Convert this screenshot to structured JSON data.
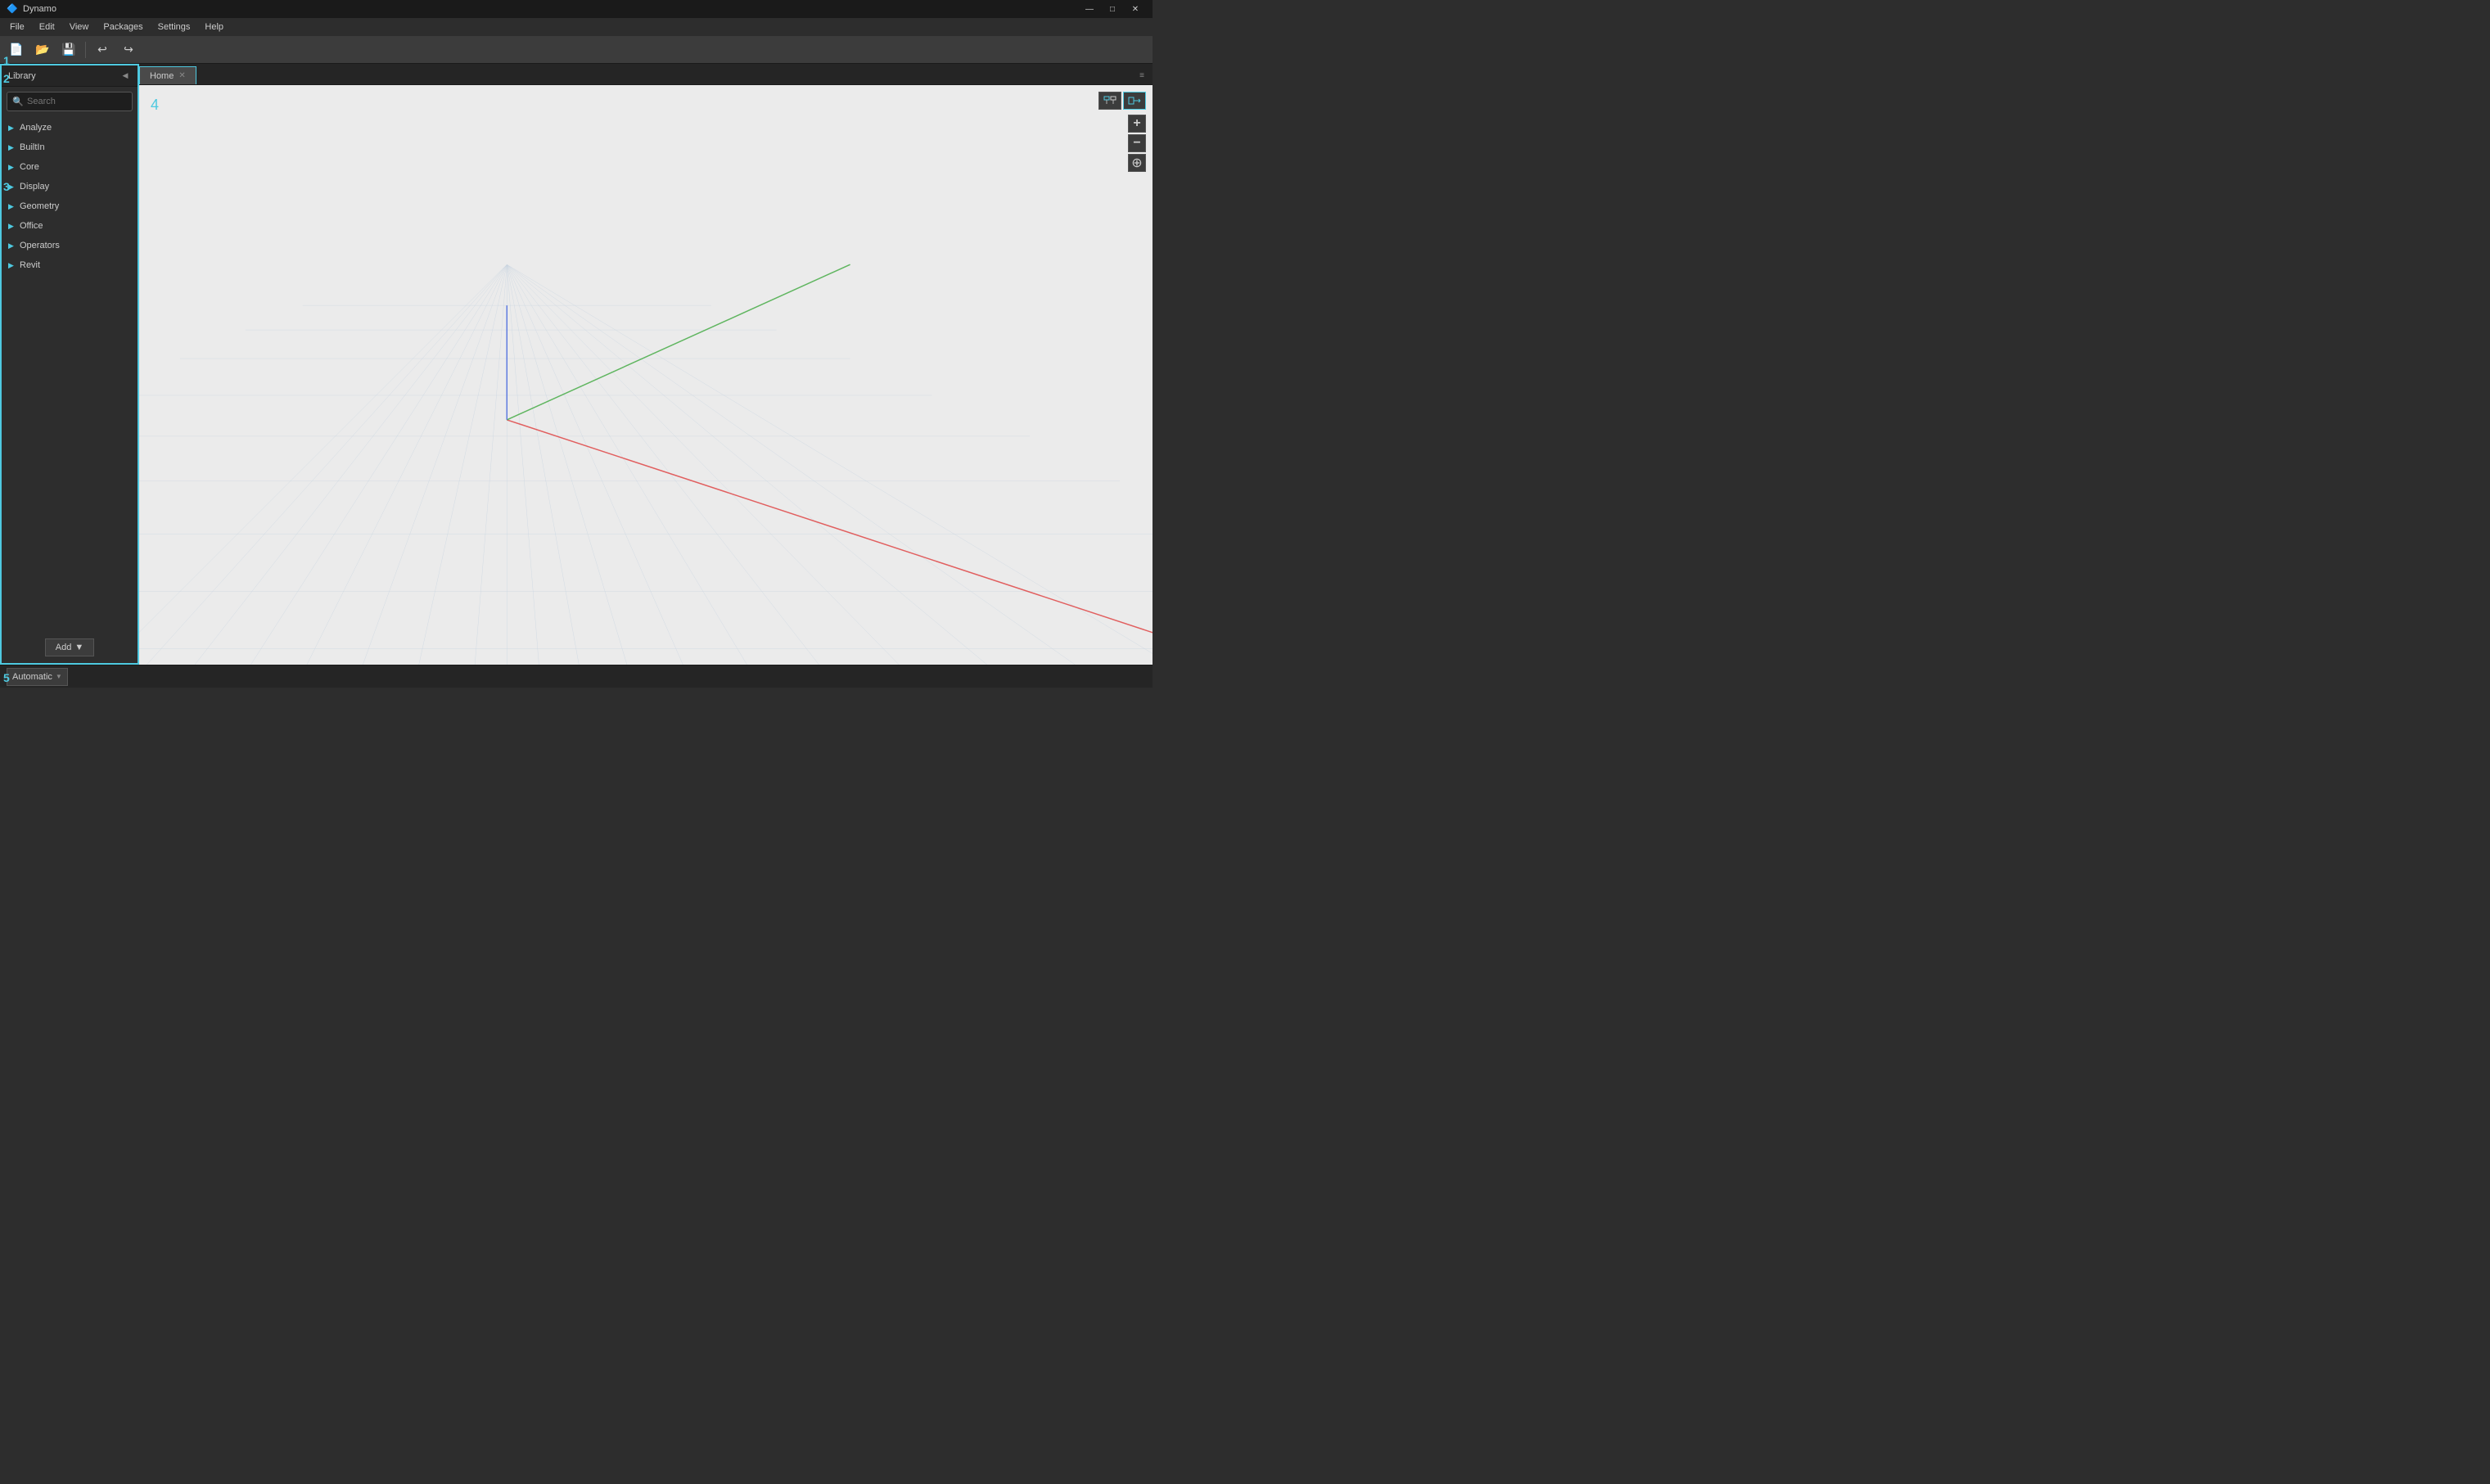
{
  "app": {
    "name": "Dynamo",
    "icon": "🔷"
  },
  "titlebar": {
    "minimize": "—",
    "maximize": "□",
    "close": "✕"
  },
  "menubar": {
    "items": [
      "File",
      "Edit",
      "View",
      "Packages",
      "Settings",
      "Help"
    ]
  },
  "toolbar": {
    "buttons": [
      "📄",
      "📂",
      "💾"
    ]
  },
  "sidebar": {
    "title": "Library",
    "search_placeholder": "Search",
    "items": [
      {
        "label": "Analyze",
        "expanded": false
      },
      {
        "label": "BuiltIn",
        "expanded": false
      },
      {
        "label": "Core",
        "expanded": false
      },
      {
        "label": "Display",
        "expanded": false
      },
      {
        "label": "Geometry",
        "expanded": false
      },
      {
        "label": "Office",
        "expanded": false
      },
      {
        "label": "Operators",
        "expanded": false
      },
      {
        "label": "Revit",
        "expanded": false
      }
    ],
    "add_button": "Add"
  },
  "tabs": [
    {
      "label": "Home",
      "active": true
    }
  ],
  "markers": {
    "n1": "1",
    "n2": "2",
    "n3": "3",
    "n4": "4",
    "n5": "5"
  },
  "viewport": {
    "label": "4"
  },
  "statusbar": {
    "execution_label": "Automatic",
    "dropdown_arrow": "▼"
  },
  "zoom_controls": {
    "plus": "+",
    "minus": "−",
    "fit": "⊕"
  }
}
